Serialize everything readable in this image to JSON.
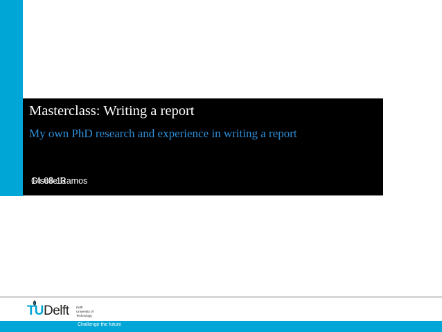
{
  "slide": {
    "title": "Masterclass: Writing a report",
    "subtitle": "My own PhD research and experience in writing a report",
    "presenter_date": "14-08-13",
    "presenter_name": "Giselle Ramos"
  },
  "footer": {
    "logo_text_tu": "TU",
    "logo_text_delft": "Delft",
    "university_name_lines": [
      "Delft",
      "University of",
      "Technology"
    ],
    "tagline": "Challenge the future"
  },
  "colors": {
    "accent": "#00a6d6",
    "title_block_bg": "#000000",
    "title_text": "#ffffff",
    "subtitle_text": "#2f8fd8"
  },
  "icons": [
    "tu-delft-flame-icon"
  ]
}
